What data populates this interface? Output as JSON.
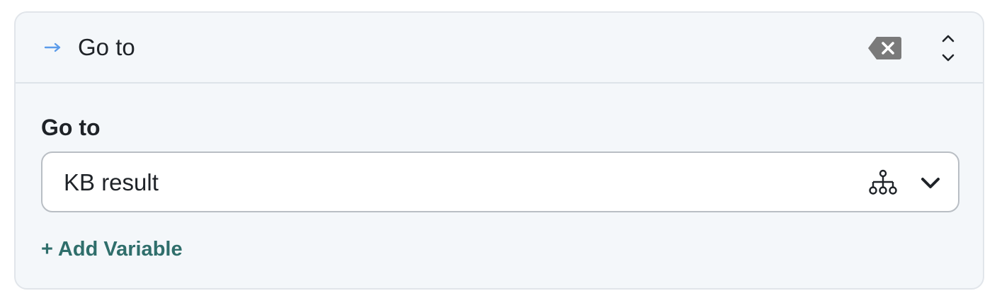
{
  "colors": {
    "card_background": "#f4f7fa",
    "card_border": "#e1e5ea",
    "header_arrow": "#5b9bea",
    "delete_icon": "#7a7a7a",
    "text_primary": "#1f2328",
    "link_accent": "#2f6e6b"
  },
  "header": {
    "icon": "arrow-right-icon",
    "title": "Go to",
    "delete_icon": "backspace-delete-icon",
    "reorder_icon": "chevron-up-down-icon"
  },
  "field": {
    "label": "Go to",
    "value": "KB result",
    "flow_icon": "sitemap-icon",
    "dropdown_icon": "chevron-down-icon"
  },
  "actions": {
    "add_variable_label": "+ Add Variable"
  }
}
